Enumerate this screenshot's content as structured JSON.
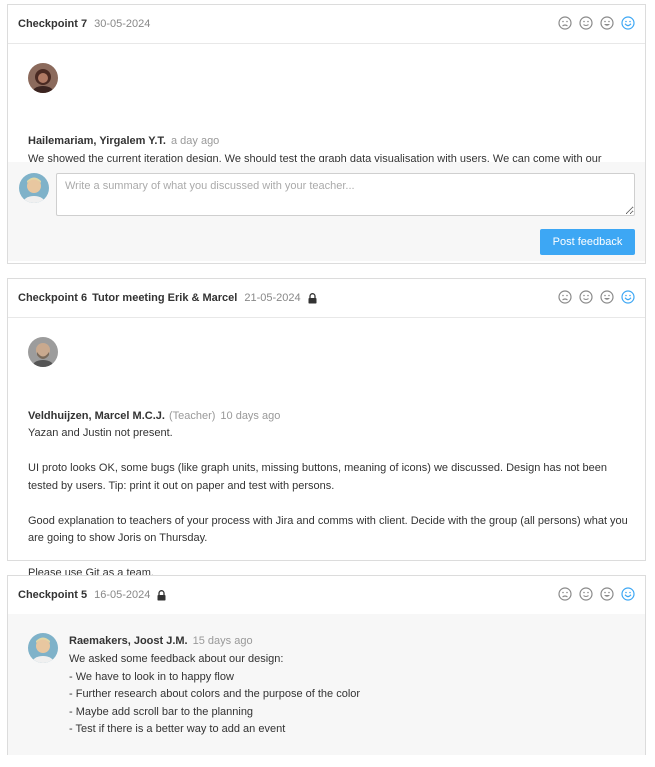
{
  "checkpoints": [
    {
      "title": "Checkpoint 7",
      "subtitle": "",
      "date": "30-05-2024",
      "locked": false,
      "comment": {
        "author": "Hailemariam, Yirgalem Y.T.",
        "role": "",
        "ago": "a day ago",
        "text": "We showed the current iteration design. We should test the graph data visualisation with users. We can come with our document on the test outcomes and give one recommendation to the client as a group."
      },
      "feedback": {
        "placeholder": "Write a summary of what you discussed with your teacher...",
        "post_label": "Post feedback"
      }
    },
    {
      "title": "Checkpoint 6",
      "subtitle": "Tutor meeting Erik & Marcel",
      "date": "21-05-2024",
      "locked": true,
      "comment": {
        "author": "Veldhuijzen, Marcel M.C.J.",
        "role": "(Teacher)",
        "ago": "10 days ago",
        "text": "Yazan and Justin not present.\n\nUI proto looks OK, some bugs (like graph units, missing buttons, meaning of icons) we discussed. Design has not been tested by users. Tip: print it out on paper and test with persons.\n\nGood explanation to teachers of your process with Jira and comms with client. Decide with the group (all persons) what you are going to show Joris on Thursday.\n\nPlease use Git as a team."
      }
    },
    {
      "title": "Checkpoint 5",
      "subtitle": "",
      "date": "16-05-2024",
      "locked": true,
      "comment": {
        "author": "Raemakers, Joost J.M.",
        "role": "",
        "ago": "15 days ago",
        "text": "We asked some feedback about our design:\n- We have to look in to happy flow\n- Further research about colors and the purpose of the color\n- Maybe add scroll bar to the planning\n- Test if there is a better way to add an event"
      }
    }
  ],
  "smileys": [
    "sad-face-icon",
    "neutral-face-icon",
    "happy-face-icon",
    "very-happy-face-icon"
  ],
  "colors": {
    "accent": "#3da7f4",
    "smiley_grey": "#8a8a8a",
    "smiley_selected": "#3da7f4"
  }
}
